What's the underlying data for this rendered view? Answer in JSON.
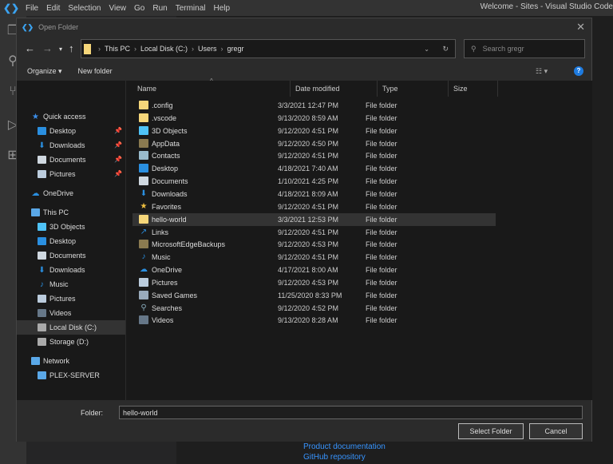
{
  "menubar": {
    "items": [
      "File",
      "Edit",
      "Selection",
      "View",
      "Go",
      "Run",
      "Terminal",
      "Help"
    ],
    "window_title": "Welcome - Sites - Visual Studio Code"
  },
  "background_links": [
    "Product documentation",
    "GitHub repository"
  ],
  "dialog": {
    "title": "Open Folder",
    "breadcrumb": [
      "This PC",
      "Local Disk (C:)",
      "Users",
      "gregr"
    ],
    "search_placeholder": "Search gregr",
    "toolbar": {
      "organize": "Organize ▾",
      "new_folder": "New folder"
    },
    "columns": [
      "Name",
      "Date modified",
      "Type",
      "Size"
    ],
    "nav": [
      {
        "label": "Quick access",
        "icon": "star",
        "color": "#3b8eea",
        "indent": 0
      },
      {
        "label": "Desktop",
        "icon": "desktop",
        "color": "#2a8fe0",
        "indent": 1,
        "pinned": true
      },
      {
        "label": "Downloads",
        "icon": "download",
        "color": "#2a8fe0",
        "indent": 1,
        "pinned": true
      },
      {
        "label": "Documents",
        "icon": "document",
        "color": "#cfd8e0",
        "indent": 1,
        "pinned": true
      },
      {
        "label": "Pictures",
        "icon": "picture",
        "color": "#bcd",
        "indent": 1,
        "pinned": true
      },
      {
        "label": "OneDrive",
        "icon": "cloud",
        "color": "#2a8fe0",
        "indent": 0,
        "gap": true
      },
      {
        "label": "This PC",
        "icon": "computer",
        "color": "#5aa8e8",
        "indent": 0,
        "gap": true
      },
      {
        "label": "3D Objects",
        "icon": "cube",
        "color": "#4fc3f7",
        "indent": 1
      },
      {
        "label": "Desktop",
        "icon": "desktop",
        "color": "#2a8fe0",
        "indent": 1
      },
      {
        "label": "Documents",
        "icon": "document",
        "color": "#cfd8e0",
        "indent": 1
      },
      {
        "label": "Downloads",
        "icon": "download",
        "color": "#2a8fe0",
        "indent": 1
      },
      {
        "label": "Music",
        "icon": "music",
        "color": "#2a8fe0",
        "indent": 1
      },
      {
        "label": "Pictures",
        "icon": "picture",
        "color": "#bcd",
        "indent": 1
      },
      {
        "label": "Videos",
        "icon": "video",
        "color": "#678",
        "indent": 1
      },
      {
        "label": "Local Disk (C:)",
        "icon": "drive",
        "color": "#aaa",
        "indent": 1,
        "selected": true
      },
      {
        "label": "Storage (D:)",
        "icon": "drive",
        "color": "#aaa",
        "indent": 1
      },
      {
        "label": "Network",
        "icon": "network",
        "color": "#5aa8e8",
        "indent": 0,
        "gap": true
      },
      {
        "label": "PLEX-SERVER",
        "icon": "computer",
        "color": "#5aa8e8",
        "indent": 1
      }
    ],
    "files": [
      {
        "name": ".config",
        "date": "3/3/2021 12:47 PM",
        "type": "File folder",
        "icon": "folder",
        "color": "#f5d67a"
      },
      {
        "name": ".vscode",
        "date": "9/13/2020 8:59 AM",
        "type": "File folder",
        "icon": "folder",
        "color": "#f5d67a"
      },
      {
        "name": "3D Objects",
        "date": "9/12/2020 4:51 PM",
        "type": "File folder",
        "icon": "cube",
        "color": "#4fc3f7"
      },
      {
        "name": "AppData",
        "date": "9/12/2020 4:50 PM",
        "type": "File folder",
        "icon": "folder",
        "color": "#8a7a50"
      },
      {
        "name": "Contacts",
        "date": "9/12/2020 4:51 PM",
        "type": "File folder",
        "icon": "contacts",
        "color": "#9bc"
      },
      {
        "name": "Desktop",
        "date": "4/18/2021 7:40 AM",
        "type": "File folder",
        "icon": "desktop",
        "color": "#2a8fe0"
      },
      {
        "name": "Documents",
        "date": "1/10/2021 4:25 PM",
        "type": "File folder",
        "icon": "document",
        "color": "#cfd8e0"
      },
      {
        "name": "Downloads",
        "date": "4/18/2021 8:09 AM",
        "type": "File folder",
        "icon": "download",
        "color": "#2a8fe0"
      },
      {
        "name": "Favorites",
        "date": "9/12/2020 4:51 PM",
        "type": "File folder",
        "icon": "star",
        "color": "#f0c040"
      },
      {
        "name": "hello-world",
        "date": "3/3/2021 12:53 PM",
        "type": "File folder",
        "icon": "folder",
        "color": "#f5d67a",
        "selected": true
      },
      {
        "name": "Links",
        "date": "9/12/2020 4:51 PM",
        "type": "File folder",
        "icon": "link",
        "color": "#2a8fe0"
      },
      {
        "name": "MicrosoftEdgeBackups",
        "date": "9/12/2020 4:53 PM",
        "type": "File folder",
        "icon": "folder",
        "color": "#8a7a50"
      },
      {
        "name": "Music",
        "date": "9/12/2020 4:51 PM",
        "type": "File folder",
        "icon": "music",
        "color": "#2a8fe0"
      },
      {
        "name": "OneDrive",
        "date": "4/17/2021 8:00 AM",
        "type": "File folder",
        "icon": "cloud",
        "color": "#2a8fe0"
      },
      {
        "name": "Pictures",
        "date": "9/12/2020 4:53 PM",
        "type": "File folder",
        "icon": "picture",
        "color": "#bcd"
      },
      {
        "name": "Saved Games",
        "date": "11/25/2020 8:33 PM",
        "type": "File folder",
        "icon": "saved-games",
        "color": "#9ab"
      },
      {
        "name": "Searches",
        "date": "9/12/2020 4:52 PM",
        "type": "File folder",
        "icon": "search",
        "color": "#8ab"
      },
      {
        "name": "Videos",
        "date": "9/13/2020 8:28 AM",
        "type": "File folder",
        "icon": "video",
        "color": "#678"
      }
    ],
    "folder_label": "Folder:",
    "folder_value": "hello-world",
    "select_button": "Select Folder",
    "cancel_button": "Cancel"
  }
}
